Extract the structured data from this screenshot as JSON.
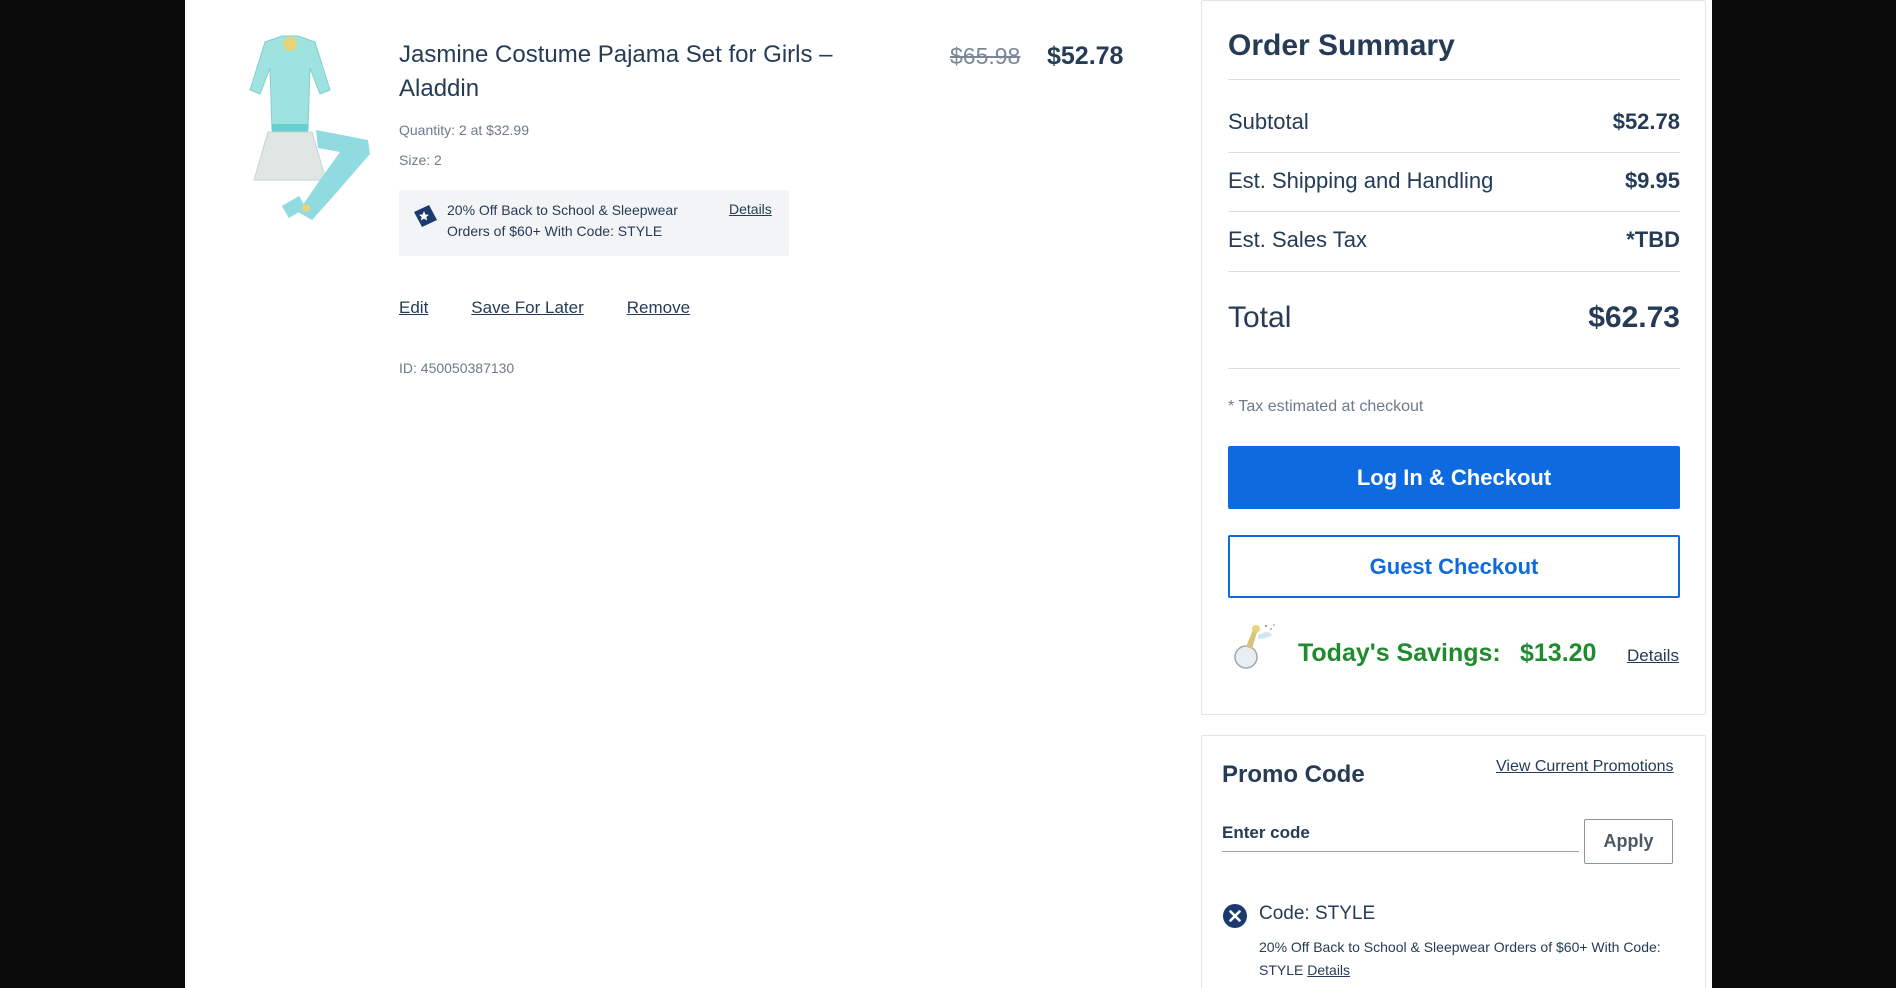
{
  "item": {
    "title": "Jasmine Costume Pajama Set for Girls – Aladdin",
    "quantity_text": "Quantity: 2 at $32.99",
    "size_text": "Size: 2",
    "original_price": "$65.98",
    "price": "$52.78",
    "promo": {
      "text": "20% Off Back to School & Sleepwear Orders of $60+ With Code: STYLE",
      "details_label": "Details"
    },
    "actions": {
      "edit": "Edit",
      "save_for_later": "Save For Later",
      "remove": "Remove"
    },
    "id_text": "ID: 450050387130",
    "image_icon": "pajama-set-image"
  },
  "summary": {
    "title": "Order Summary",
    "rows": [
      {
        "label": "Subtotal",
        "value": "$52.78"
      },
      {
        "label": "Est. Shipping and Handling",
        "value": "$9.95"
      },
      {
        "label": "Est. Sales Tax",
        "value": "*TBD"
      }
    ],
    "total_label": "Total",
    "total_value": "$62.73",
    "tax_note": "* Tax estimated at checkout",
    "login_checkout": "Log In & Checkout",
    "guest_checkout": "Guest Checkout",
    "savings_label": "Today's Savings:",
    "savings_value": "$13.20",
    "savings_details": "Details",
    "savings_icon": "tinker-bell-icon"
  },
  "promo_code": {
    "title": "Promo Code",
    "view_promotions": "View Current Promotions",
    "input_placeholder": "Enter code",
    "apply_label": "Apply",
    "applied_code": "Code: STYLE",
    "applied_desc": "20% Off Back to School & Sleepwear Orders of $60+ With Code: STYLE",
    "applied_details": "Details"
  },
  "colors": {
    "primary_blue": "#0e6bdf",
    "savings_green": "#1f8a2e",
    "text_navy": "#253b56"
  }
}
